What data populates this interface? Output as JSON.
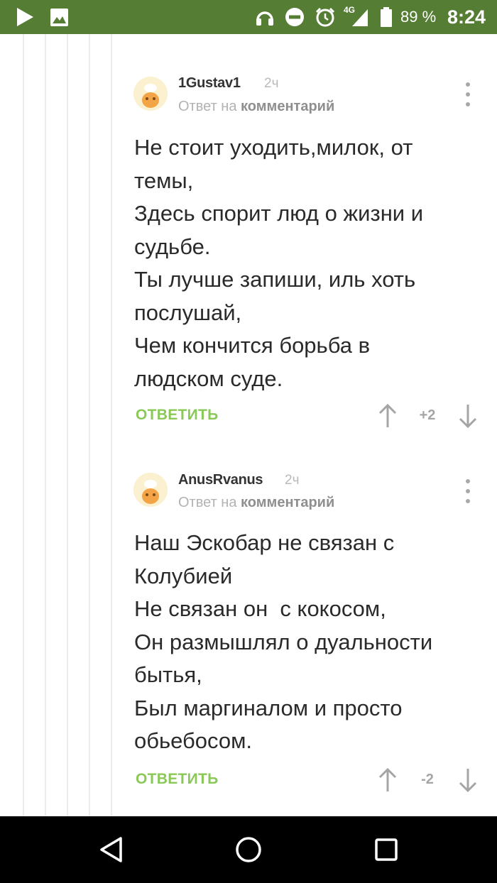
{
  "status_bar": {
    "battery_percent": "89 %",
    "network": "4G",
    "time": "8:24"
  },
  "comments": [
    {
      "username": "1Gustav1",
      "time": "2ч",
      "reply_prefix": "Ответ на",
      "reply_target": "комментарий",
      "lines": [
        "Не стоит уходить,милок, от",
        "темы,",
        "Здесь спорит люд о жизни и",
        "судьбе.",
        "Ты лучше запиши, иль хоть",
        "послушай,",
        "Чем кончится борьба в",
        "людском суде."
      ],
      "reply_label": "ОТВЕТИТЬ",
      "rating": "+2"
    },
    {
      "username": "AnusRvanus",
      "time": "2ч",
      "reply_prefix": "Ответ на",
      "reply_target": "комментарий",
      "lines": [
        "Наш Эскобар не связан с",
        "Колубией",
        "Не связан он  с кокосом,",
        "Он размышлял о дуальности",
        "бытья,",
        "Был маргиналом и просто",
        "обьебосом."
      ],
      "reply_label": "ОТВЕТИТЬ",
      "rating": "-2"
    }
  ],
  "colors": {
    "status_bar": "#557d34",
    "reply_button": "#8ac858",
    "nav_bar": "#000000"
  }
}
